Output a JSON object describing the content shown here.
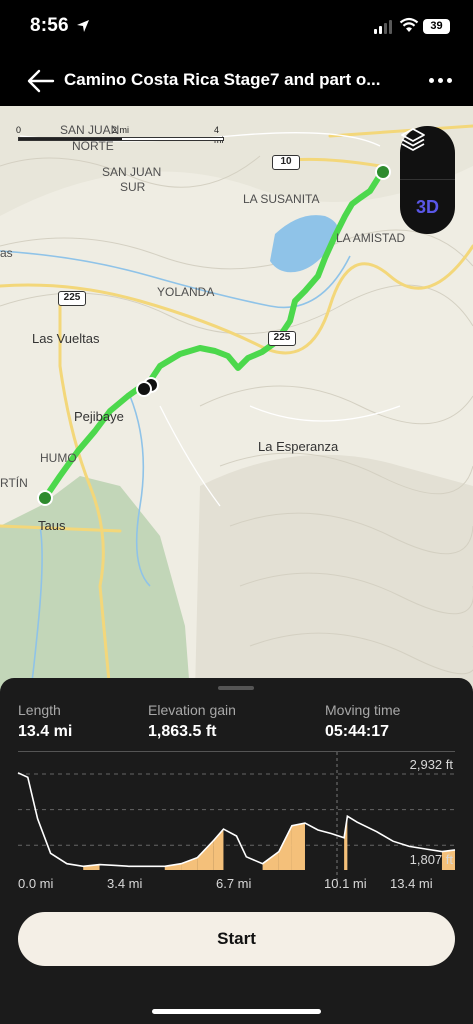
{
  "status_bar": {
    "time": "8:56",
    "battery": "39"
  },
  "header": {
    "title": "Camino Costa Rica Stage7 and part o..."
  },
  "map": {
    "scale": {
      "zero": "0",
      "mid": "2 mi",
      "end": "4 mi"
    },
    "labels": {
      "san_juan_norte": "SAN JUAN",
      "norte": "NORTE",
      "san_juan_sur": "SAN JUAN",
      "sur": "SUR",
      "la_susanita": "LA SUSANITA",
      "la_amistad": "LA AMISTAD",
      "yolanda": "YOLANDA",
      "las_vueltas": "Las Vueltas",
      "pejibaye": "Pejibaye",
      "humo": "HUMO",
      "la_esperanza": "La Esperanza",
      "taus": "Taus",
      "martin": "RTÍN",
      "as": "as"
    },
    "road_shields": {
      "r10": "10",
      "r225_a": "225",
      "r225_b": "225"
    },
    "controls": {
      "three_d": "3D",
      "layers_icon": "layers-icon"
    },
    "route_color": "#4cd84c"
  },
  "stats": {
    "length_label": "Length",
    "length_value": "13.4 mi",
    "elevation_label": "Elevation gain",
    "elevation_value": "1,863.5 ft",
    "moving_label": "Moving time",
    "moving_value": "05:44:17"
  },
  "chart_data": {
    "type": "area",
    "y_max_label": "2,932 ft",
    "y_min_label": "1,807 ft",
    "x_labels": [
      "0.0 mi",
      "3.4 mi",
      "6.7 mi",
      "10.1 mi",
      "13.4 mi"
    ],
    "ylim": [
      1807,
      2932
    ],
    "xlim": [
      0,
      13.4
    ],
    "x": [
      0,
      0.3,
      0.6,
      1.0,
      1.5,
      2.0,
      2.5,
      3.0,
      3.4,
      4.0,
      4.5,
      5.0,
      5.5,
      6.0,
      6.3,
      6.7,
      7.0,
      7.5,
      8.0,
      8.4,
      8.8,
      9.2,
      9.6,
      10.0,
      10.1,
      10.4,
      11.0,
      11.5,
      12.0,
      12.5,
      13.0,
      13.4
    ],
    "y": [
      2932,
      2880,
      2400,
      2000,
      1880,
      1850,
      1870,
      1860,
      1850,
      1850,
      1850,
      1880,
      1950,
      2150,
      2280,
      2200,
      1960,
      1880,
      2020,
      2320,
      2350,
      2270,
      2230,
      2180,
      2430,
      2360,
      2250,
      2140,
      2080,
      2050,
      2020,
      2040
    ],
    "uphill_color": "#f4c07a",
    "line_color": "#ffffff"
  },
  "actions": {
    "start": "Start"
  }
}
